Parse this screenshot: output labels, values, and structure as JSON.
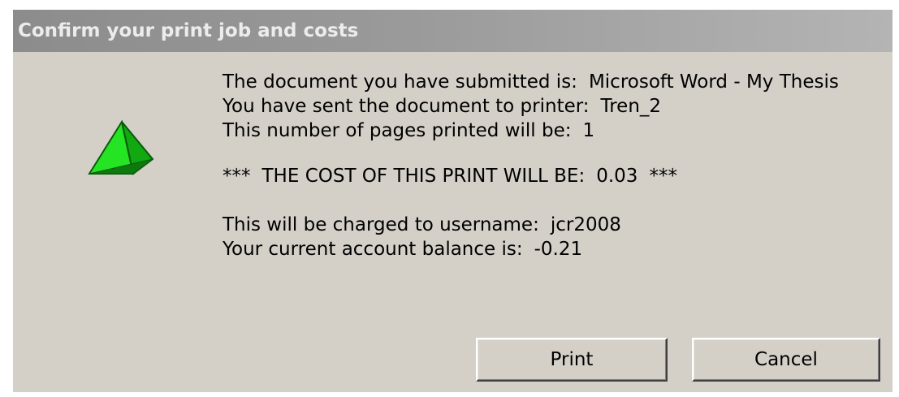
{
  "dialog": {
    "title": "Confirm your print job and costs"
  },
  "message": {
    "document_label": "The document you have submitted is:",
    "document_value": "Microsoft Word - My Thesis",
    "printer_label": "You have sent the document to printer:",
    "printer_value": "Tren_2",
    "pages_label": "This number of pages printed will be:",
    "pages_value": "1",
    "cost_prefix": "***",
    "cost_label": "THE COST OF THIS PRINT WILL BE:",
    "cost_value": "0.03",
    "cost_suffix": "***",
    "username_label": "This will be charged to username:",
    "username_value": "jcr2008",
    "balance_label": "Your current account balance is:",
    "balance_value": "-0.21"
  },
  "buttons": {
    "print_label": "Print",
    "cancel_label": "Cancel"
  },
  "icon": {
    "name": "green-pyramid-icon",
    "color_light": "#22e622",
    "color_dark": "#0b8a0b"
  }
}
